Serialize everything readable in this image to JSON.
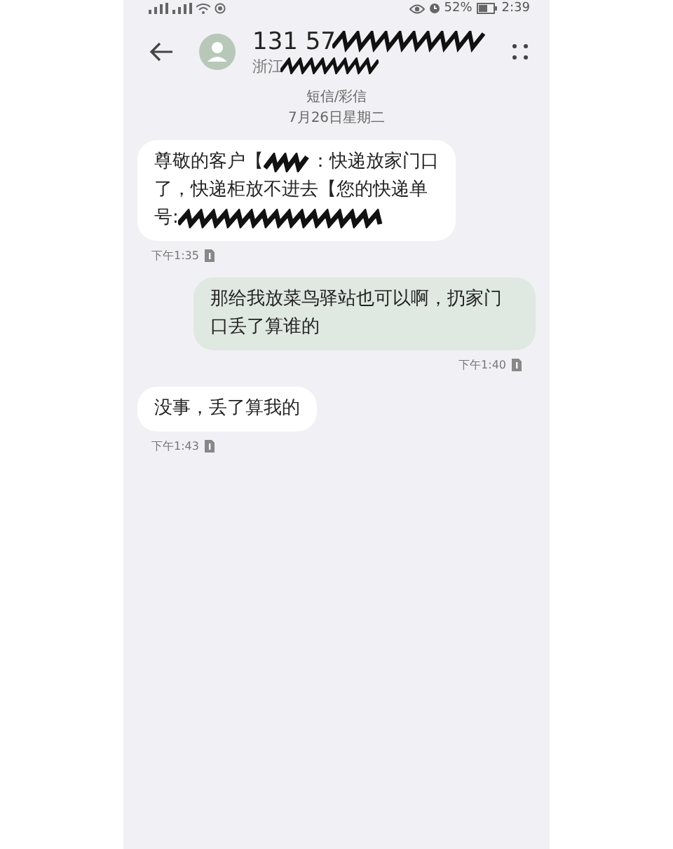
{
  "status_bar": {
    "battery": "52%",
    "time": "2:39"
  },
  "header": {
    "name": "131 57",
    "location": "浙江"
  },
  "thread_label": "短信/彩信",
  "date": "7月26日星期二",
  "messages": [
    {
      "kind": "incoming",
      "time": "下午1:35",
      "lines": [
        [
          {
            "kind": "text",
            "text": "尊敬的客户【"
          },
          {
            "kind": "redaction"
          },
          {
            "kind": "text",
            "text": "：快递放家门口"
          }
        ],
        [
          {
            "kind": "text",
            "text": "了，快递柜放不进去【您的快递单"
          }
        ],
        [
          {
            "kind": "text",
            "text": "号:"
          },
          {
            "kind": "redaction"
          }
        ]
      ]
    },
    {
      "kind": "outgoing",
      "time": "下午1:40",
      "text": "那给我放菜鸟驿站也可以啊，扔家门口丢了算谁的"
    },
    {
      "kind": "incoming",
      "time": "下午1:43",
      "text": "没事，丢了算我的"
    }
  ]
}
